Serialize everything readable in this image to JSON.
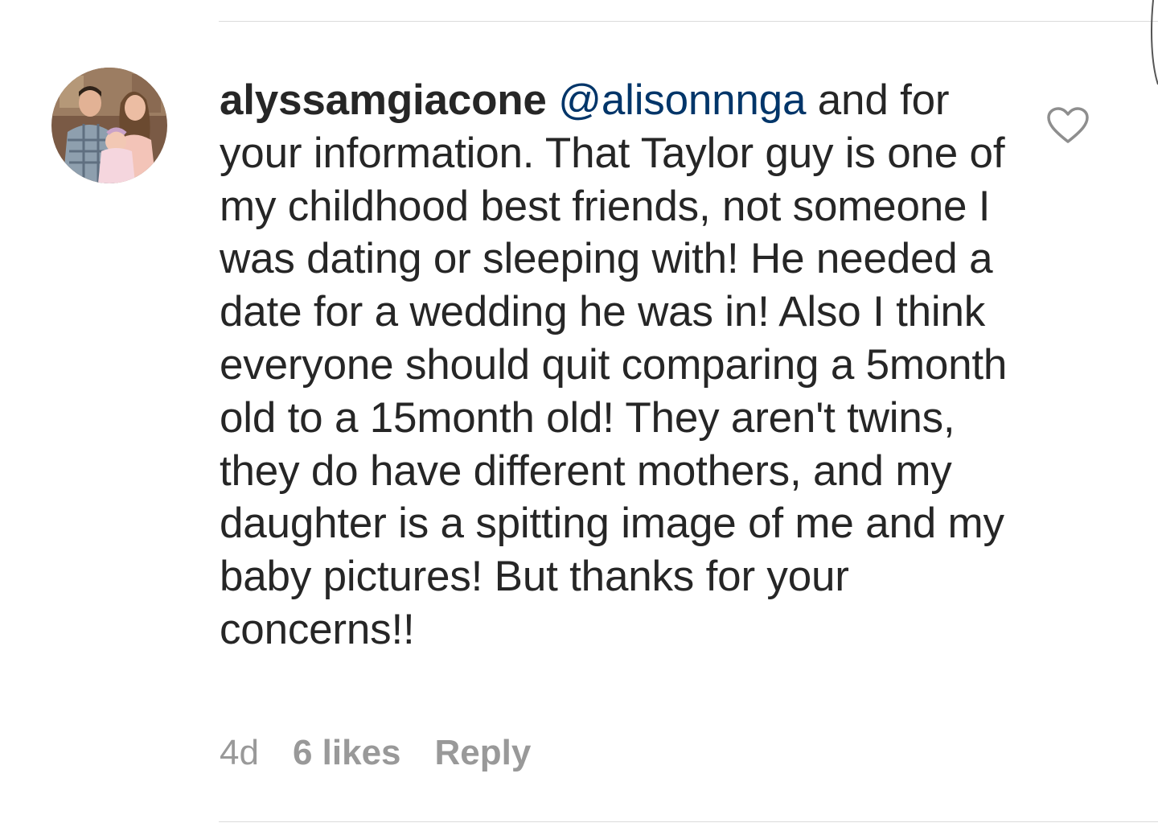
{
  "comment": {
    "username": "alyssamgiacone",
    "mention": "@alisonnnga",
    "text": "and for your information. That Taylor guy is one of my childhood best friends, not someone I was dating or sleeping with! He needed a date for a wedding he was in! Also I think everyone should quit comparing a 5month old to a 15month old! They aren't twins, they do have different mothers, and my daughter is a spitting image of me and my baby pictures! But thanks for your concerns!!",
    "time": "4d",
    "likes": "6 likes",
    "reply_label": "Reply"
  },
  "icons": {
    "like": "heart-outline-icon",
    "avatar": "profile-photo"
  },
  "colors": {
    "text": "#262626",
    "mention": "#003569",
    "meta": "#999999",
    "divider": "#dbdbdb"
  }
}
